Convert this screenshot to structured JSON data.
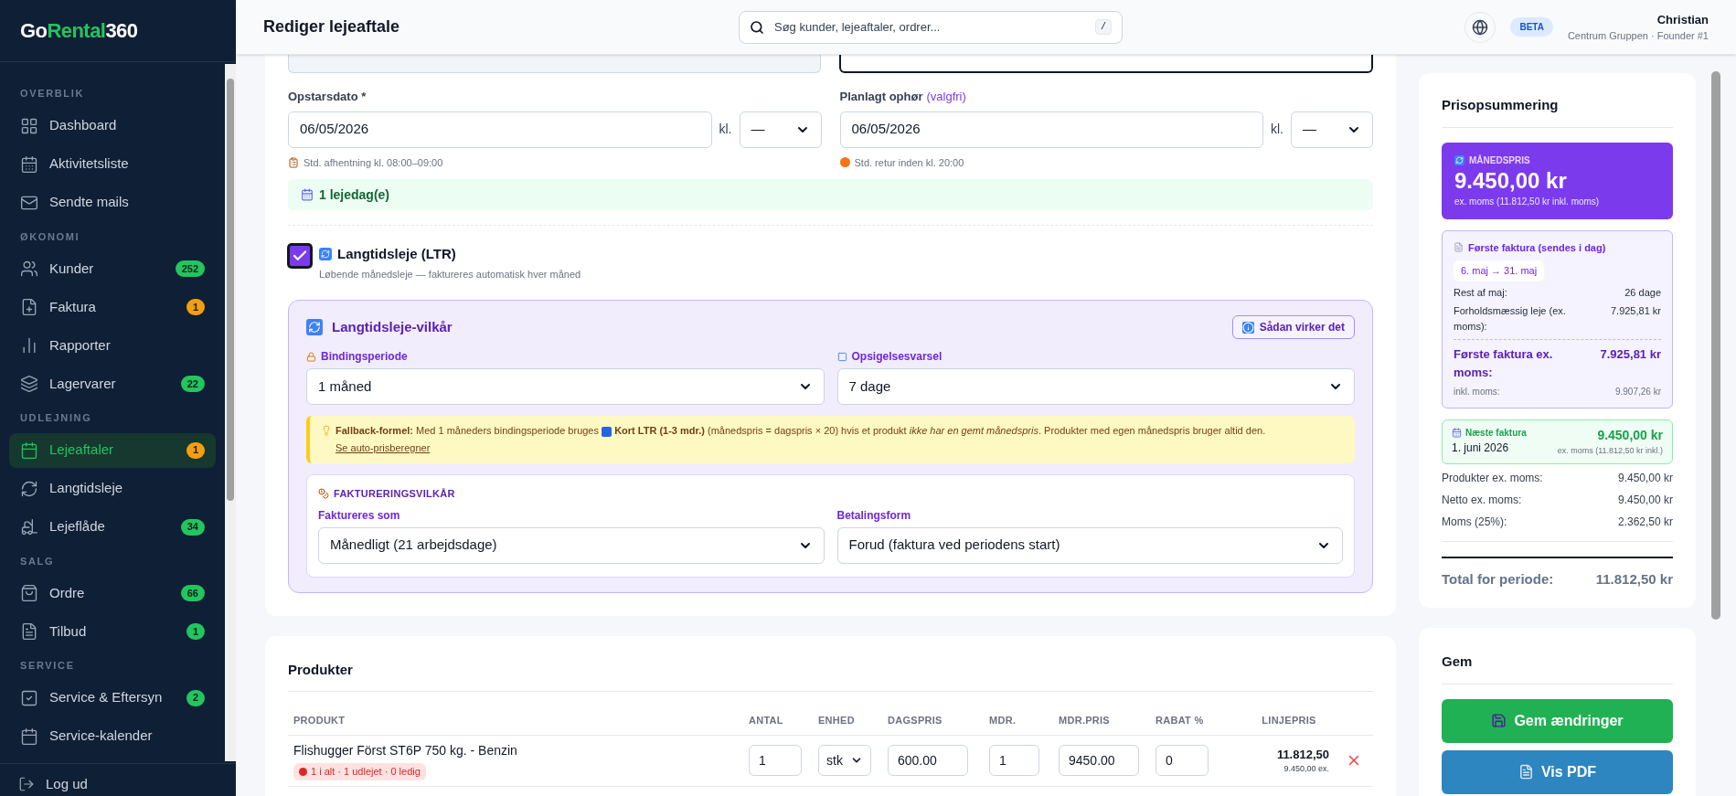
{
  "brand": {
    "lead": "Go",
    "highlight": "Rental",
    "tail": "360"
  },
  "sidebar": {
    "sections": [
      {
        "title": "OVERBLIK",
        "items": [
          {
            "label": "Dashboard",
            "selected": false
          },
          {
            "label": "Aktivitetsliste",
            "selected": false
          },
          {
            "label": "Sendte mails",
            "selected": false
          }
        ]
      },
      {
        "title": "ØKONOMI",
        "items": [
          {
            "label": "Kunder",
            "selected": false,
            "badge": {
              "text": "252",
              "color": "#22c55e"
            }
          },
          {
            "label": "Faktura",
            "selected": false,
            "badge": {
              "text": "1",
              "color": "#f59e0b"
            }
          },
          {
            "label": "Rapporter",
            "selected": false
          },
          {
            "label": "Lagervarer",
            "selected": false,
            "badge": {
              "text": "22",
              "color": "#22c55e"
            }
          }
        ]
      },
      {
        "title": "UDLEJNING",
        "items": [
          {
            "label": "Lejeaftaler",
            "selected": true,
            "badge": {
              "text": "1",
              "color": "#f59e0b"
            }
          },
          {
            "label": "Langtidsleje",
            "selected": false
          },
          {
            "label": "Lejeflåde",
            "selected": false,
            "badge": {
              "text": "34",
              "color": "#22c55e"
            }
          }
        ]
      },
      {
        "title": "SALG",
        "items": [
          {
            "label": "Ordre",
            "selected": false,
            "badge": {
              "text": "66",
              "color": "#22c55e"
            }
          },
          {
            "label": "Tilbud",
            "selected": false,
            "badge": {
              "text": "1",
              "color": "#22c55e"
            }
          }
        ]
      },
      {
        "title": "SERVICE",
        "items": [
          {
            "label": "Service & Eftersyn",
            "selected": false,
            "badge": {
              "text": "2",
              "color": "#22c55e"
            }
          },
          {
            "label": "Service-kalender",
            "selected": false
          }
        ]
      }
    ],
    "logout": "Log ud"
  },
  "header": {
    "title": "Rediger lejeaftale",
    "search_placeholder": "Søg kunder, lejeaftaler, ordrer...",
    "shortcut": "/",
    "beta": "BETA",
    "user_name": "Christian",
    "user_sub": "Centrum Gruppen · Founder #1"
  },
  "dates": [
    {
      "label": "Opstarsdato *",
      "value": "06/05/2026",
      "kl": "kl.",
      "time": "—",
      "hint": "Std. afhentning kl. 08:00–09:00"
    },
    {
      "label": "Planlagt ophør",
      "optional": "(valgfri)",
      "value": "06/05/2026",
      "kl": "kl.",
      "time": "—",
      "hint": "Std. retur inden kl. 20:00"
    }
  ],
  "rental_days": "1 lejedag(e)",
  "ltr": {
    "checked": true,
    "title": "Langtidsleje (LTR)",
    "subtitle": "Løbende månedsleje — faktureres automatisk hver måned"
  },
  "ltr_terms": {
    "title": "Langtidsleje-vilkår",
    "help": "Sådan virker det",
    "fields": [
      {
        "label": "Bindingsperiode",
        "value": "1 måned"
      },
      {
        "label": "Opsigelsesvarsel",
        "value": "7 dage"
      }
    ],
    "note_before": "**Fallback-formel:** Med 1 måneders bindingsperiode bruges",
    "note_after": "**Kort LTR (1-3 mdr.)** (månedspris = dagspris × 20) hvis et produkt *ikke har en gemt månedspris*. Produkter med egen månedspris bruger altid den.",
    "note_link": "Se auto-prisberegner",
    "billing": {
      "title": "FAKTURERINGSVILKÅR",
      "fields": [
        {
          "label": "Faktureres som",
          "value": "Månedligt (21 arbejdsdage)"
        },
        {
          "label": "Betalingsform",
          "value": "Forud (faktura ved periodens start)"
        }
      ]
    }
  },
  "products": {
    "title": "Produkter",
    "columns": [
      "PRODUKT",
      "ANTAL",
      "ENHED",
      "DAGSPRIS",
      "MDR.",
      "MDR.PRIS",
      "RABAT %",
      "LINJEPRIS"
    ],
    "rows": [
      {
        "name": "Flishugger Först ST6P 750 kg. - Benzin",
        "stock": "1 i alt · 1 udlejet · 0 ledig",
        "qty": "1",
        "unit": "stk",
        "day_price": "600.00",
        "months": "1",
        "month_price": "9450.00",
        "discount": "0",
        "line_total": "11.812,50",
        "line_sub": "9.450,00 ex."
      }
    ]
  },
  "summary": {
    "title": "Prisopsummering",
    "monthly": {
      "label": "MÅNEDSPRIS",
      "amount": "9.450,00 kr",
      "sub": "ex. moms (11.812,50 kr inkl. moms)"
    },
    "first_invoice": {
      "title": "Første faktura (sendes i dag)",
      "period": "6. maj → 31. maj",
      "rows": [
        {
          "label": "Rest af maj:",
          "value": "26 dage"
        },
        {
          "label": "Forholdsmæssig leje (ex. moms):",
          "value": "7.925,81 kr"
        }
      ],
      "total_label": "Første faktura ex. moms:",
      "total_value": "7.925,81 kr",
      "incl_label": "inkl. moms:",
      "incl_value": "9.907,26 kr"
    },
    "next_invoice": {
      "title": "Næste faktura",
      "date": "1. juni 2026",
      "amount": "9.450,00 kr",
      "sub": "ex. moms (11.812,50 kr inkl.)"
    },
    "lines": [
      {
        "label": "Produkter ex. moms:",
        "value": "9.450,00 kr"
      },
      {
        "label": "Netto ex. moms:",
        "value": "9.450,00 kr"
      },
      {
        "label": "Moms (25%):",
        "value": "2.362,50 kr"
      }
    ],
    "total_label": "Total for periode:",
    "total_value": "11.812,50 kr"
  },
  "save": {
    "title": "Gem",
    "buttons": [
      {
        "kind": "primary",
        "label": "Gem ændringer"
      },
      {
        "kind": "secondary",
        "label": "Vis PDF"
      }
    ]
  }
}
